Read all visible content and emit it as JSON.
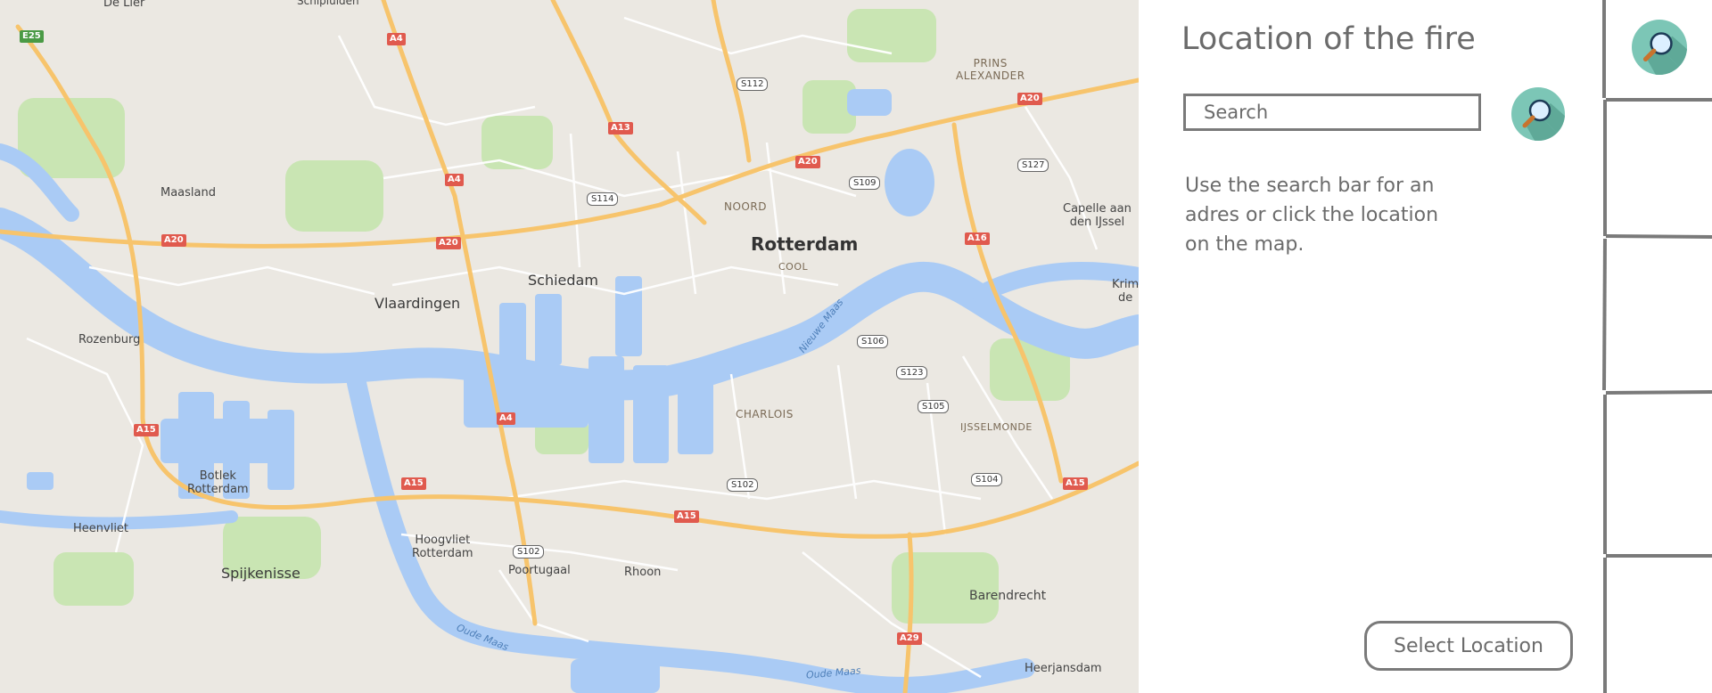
{
  "map": {
    "places": [
      {
        "id": "rotterdam",
        "label": "Rotterdam"
      },
      {
        "id": "cool",
        "label": "COOL"
      },
      {
        "id": "noord",
        "label": "NOORD"
      },
      {
        "id": "charlois",
        "label": "CHARLOIS"
      },
      {
        "id": "ijsselmonde",
        "label": "IJSSELMONDE"
      },
      {
        "id": "prins-alexander",
        "label": "PRINS\nALEXANDER"
      },
      {
        "id": "schiedam",
        "label": "Schiedam"
      },
      {
        "id": "vlaardingen",
        "label": "Vlaardingen"
      },
      {
        "id": "maasland",
        "label": "Maasland"
      },
      {
        "id": "rozenburg",
        "label": "Rozenburg"
      },
      {
        "id": "botlek",
        "label": "Botlek\nRotterdam"
      },
      {
        "id": "heenvliet",
        "label": "Heenvliet"
      },
      {
        "id": "spijkenisse",
        "label": "Spijkenisse"
      },
      {
        "id": "hoogvliet",
        "label": "Hoogvliet\nRotterdam"
      },
      {
        "id": "poortugaal",
        "label": "Poortugaal"
      },
      {
        "id": "rhoon",
        "label": "Rhoon"
      },
      {
        "id": "barendrecht",
        "label": "Barendrecht"
      },
      {
        "id": "heerjansdam",
        "label": "Heerjansdam"
      },
      {
        "id": "capelle",
        "label": "Capelle aan\nden IJssel"
      },
      {
        "id": "krim",
        "label": "Krim\nde"
      },
      {
        "id": "de-lier",
        "label": "De Lier"
      },
      {
        "id": "schipluiden",
        "label": "Schipluiden"
      },
      {
        "id": "nieuwe-maas",
        "label": "Nieuwe Maas"
      },
      {
        "id": "oude-maas-1",
        "label": "Oude Maas"
      },
      {
        "id": "oude-maas-2",
        "label": "Oude Maas"
      }
    ],
    "road_shields": [
      {
        "id": "e25",
        "label": "E25"
      },
      {
        "id": "a4-1",
        "label": "A4"
      },
      {
        "id": "a4-2",
        "label": "A4"
      },
      {
        "id": "a4-3",
        "label": "A4"
      },
      {
        "id": "a13",
        "label": "A13"
      },
      {
        "id": "a20-1",
        "label": "A20"
      },
      {
        "id": "a20-2",
        "label": "A20"
      },
      {
        "id": "a20-3",
        "label": "A20"
      },
      {
        "id": "a20-4",
        "label": "A20"
      },
      {
        "id": "a16",
        "label": "A16"
      },
      {
        "id": "a15-1",
        "label": "A15"
      },
      {
        "id": "a15-2",
        "label": "A15"
      },
      {
        "id": "a15-3",
        "label": "A15"
      },
      {
        "id": "a15-4",
        "label": "A15"
      },
      {
        "id": "a29",
        "label": "A29"
      }
    ],
    "s_roads": [
      {
        "id": "s112",
        "label": "S112"
      },
      {
        "id": "s114",
        "label": "S114"
      },
      {
        "id": "s109",
        "label": "S109"
      },
      {
        "id": "s127",
        "label": "S127"
      },
      {
        "id": "s106",
        "label": "S106"
      },
      {
        "id": "s123",
        "label": "S123"
      },
      {
        "id": "s105",
        "label": "S105"
      },
      {
        "id": "s104",
        "label": "S104"
      },
      {
        "id": "s102-1",
        "label": "S102"
      },
      {
        "id": "s102-2",
        "label": "S102"
      }
    ]
  },
  "panel": {
    "title": "Location of the fire",
    "search_placeholder": "Search",
    "search_button_icon": "magnifier-icon",
    "help_text": "Use the search bar for an adres or click the location on the map.",
    "select_button": "Select Location"
  },
  "rail": {
    "search_button_icon": "magnifier-icon"
  },
  "colors": {
    "water": "#aacbf5",
    "land": "#ebe8e2",
    "highway": "#f7c46c",
    "shield": "#e05a4e",
    "accent": "#7cc6b6"
  }
}
